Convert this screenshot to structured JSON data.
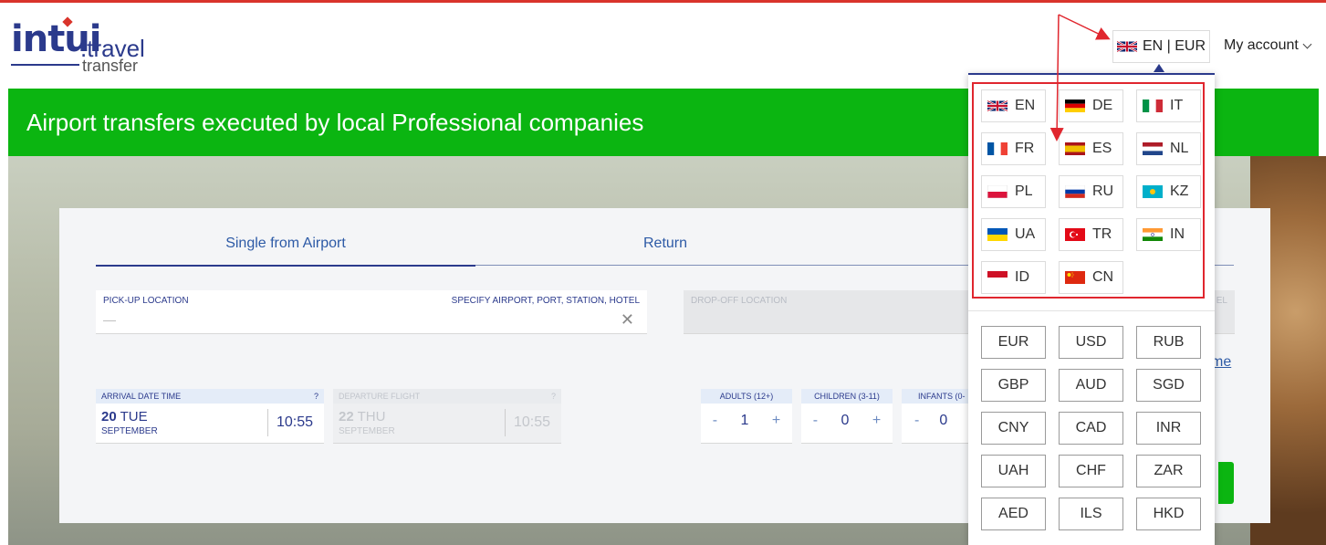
{
  "header": {
    "logo": {
      "word": "intui",
      "travel": ".travel",
      "transfer": "transfer"
    },
    "lang_button": {
      "flag_icon": "uk-flag-icon",
      "label": "EN | EUR"
    },
    "my_account": "My account"
  },
  "banner": {
    "title": "Airport transfers executed by local Professional companies",
    "color": "#0bb511"
  },
  "search": {
    "tabs": [
      {
        "label": "Single from Airport",
        "active": true
      },
      {
        "label": "Return",
        "active": false
      }
    ],
    "pickup": {
      "label": "PICK-UP LOCATION",
      "hint": "SPECIFY AIRPORT, PORT, STATION, HOTEL",
      "placeholder": "—"
    },
    "dropoff": {
      "label": "DROP-OFF LOCATION",
      "hint_partial": "EL"
    },
    "arrival": {
      "label": "ARRIVAL DATE TIME",
      "help": "?",
      "day_num": "20",
      "weekday": "TUE",
      "month": "SEPTEMBER",
      "time": "10:55"
    },
    "departure": {
      "label": "DEPARTURE FLIGHT",
      "help": "?",
      "day_num": "22",
      "weekday": "THU",
      "month": "SEPTEMBER",
      "time": "10:55"
    },
    "pax": [
      {
        "label": "ADULTS (12+)",
        "minus": "-",
        "value": "1",
        "plus": "+"
      },
      {
        "label": "CHILDREN (3-11)",
        "minus": "-",
        "value": "0",
        "plus": "+"
      },
      {
        "label": "INFANTS (0-",
        "minus": "-",
        "value": "0",
        "plus": ""
      }
    ],
    "partial_link": "me"
  },
  "dropdown": {
    "languages": [
      {
        "code": "EN",
        "flag": "uk-flag-icon"
      },
      {
        "code": "DE",
        "flag": "germany-flag-icon"
      },
      {
        "code": "IT",
        "flag": "italy-flag-icon"
      },
      {
        "code": "FR",
        "flag": "france-flag-icon"
      },
      {
        "code": "ES",
        "flag": "spain-flag-icon"
      },
      {
        "code": "NL",
        "flag": "netherlands-flag-icon"
      },
      {
        "code": "PL",
        "flag": "poland-flag-icon"
      },
      {
        "code": "RU",
        "flag": "russia-flag-icon"
      },
      {
        "code": "KZ",
        "flag": "kazakhstan-flag-icon"
      },
      {
        "code": "UA",
        "flag": "ukraine-flag-icon"
      },
      {
        "code": "TR",
        "flag": "turkey-flag-icon"
      },
      {
        "code": "IN",
        "flag": "india-flag-icon"
      },
      {
        "code": "ID",
        "flag": "indonesia-flag-icon"
      },
      {
        "code": "CN",
        "flag": "china-flag-icon"
      }
    ],
    "currencies": [
      "EUR",
      "USD",
      "RUB",
      "GBP",
      "AUD",
      "SGD",
      "CNY",
      "CAD",
      "INR",
      "UAH",
      "CHF",
      "ZAR",
      "AED",
      "ILS",
      "HKD"
    ]
  },
  "colors": {
    "brand_blue": "#2b3a8c",
    "link_blue": "#2d5aa6",
    "annotation_red": "#e0262e"
  }
}
